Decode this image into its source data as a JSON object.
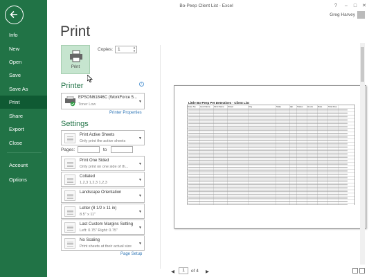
{
  "window": {
    "title": "Bo-Peep Client List - Excel",
    "user": "Greg Harvey",
    "min": "–",
    "max": "□",
    "help": "?"
  },
  "nav": {
    "items": [
      {
        "label": "Info"
      },
      {
        "label": "New"
      },
      {
        "label": "Open"
      },
      {
        "label": "Save"
      },
      {
        "label": "Save As"
      },
      {
        "label": "Print",
        "active": true
      },
      {
        "label": "Share"
      },
      {
        "label": "Export"
      },
      {
        "label": "Close"
      },
      {
        "label": "Account"
      },
      {
        "label": "Options"
      }
    ]
  },
  "page_title": "Print",
  "print_button_label": "Print",
  "copies": {
    "label": "Copies:",
    "value": "1"
  },
  "printer": {
    "heading": "Printer",
    "name": "EPSON61846C (WorkForce 5...",
    "status": "Toner Low",
    "properties_link": "Printer Properties"
  },
  "settings": {
    "heading": "Settings",
    "items": [
      {
        "title": "Print Active Sheets",
        "sub": "Only print the active sheets"
      },
      {
        "title": "Print One Sided",
        "sub": "Only print on one side of th..."
      },
      {
        "title": "Collated",
        "sub": "1,2,3    1,2,3    1,2,3"
      },
      {
        "title": "Landscape Orientation",
        "sub": ""
      },
      {
        "title": "Letter (8 1/2 x 11 in)",
        "sub": "8.5\" x 11\""
      },
      {
        "title": "Last Custom Margins Setting",
        "sub": "Left: 0.75\"    Right: 0.75\""
      },
      {
        "title": "No Scaling",
        "sub": "Print sheets at their actual size"
      }
    ],
    "pages_label": "Pages:",
    "to_label": "to",
    "page_setup_link": "Page Setup"
  },
  "preview": {
    "sheet_title": "Little Bo-Peep Pet Detectives - Client List",
    "headers": [
      "Case No",
      "Last Name",
      "First Name",
      "Street",
      "City",
      "State",
      "Zip",
      "Status",
      "Hours",
      "Rate",
      "Total Due"
    ],
    "row_count": 29,
    "current_page": "1",
    "of_label": "of 4"
  }
}
